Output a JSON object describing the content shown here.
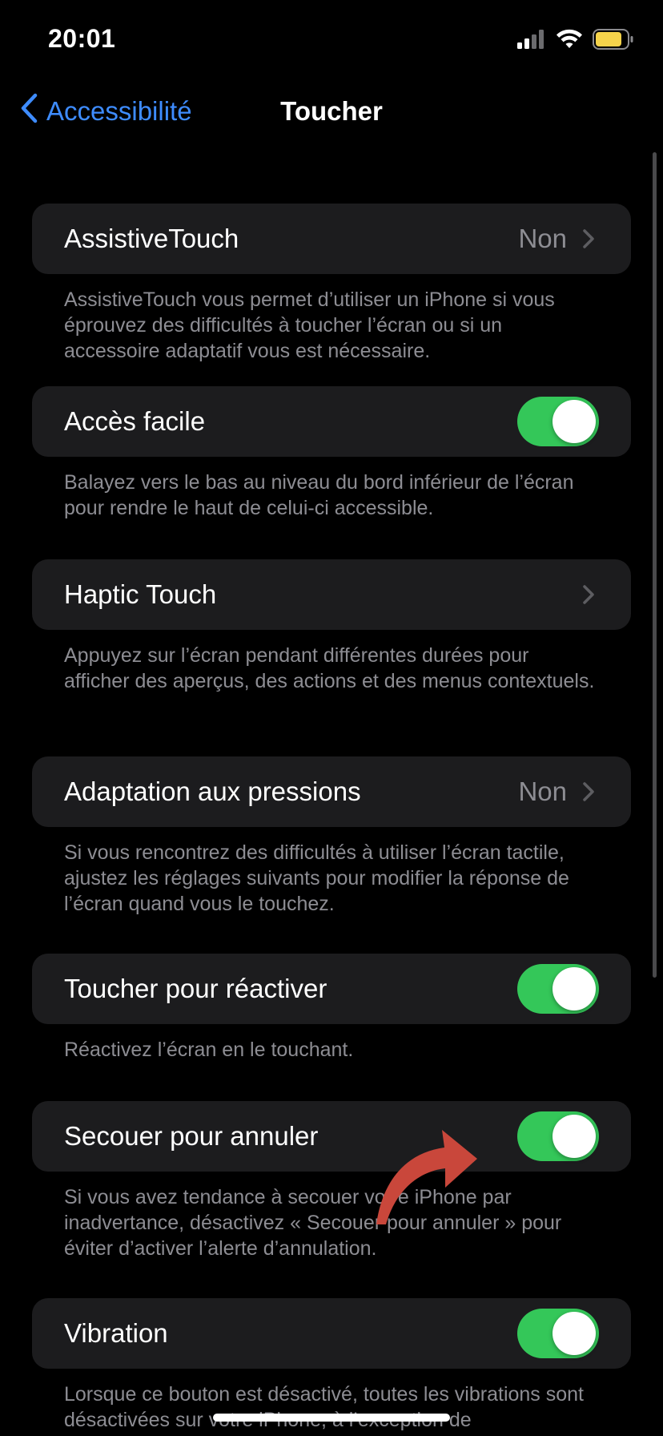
{
  "status_bar": {
    "time": "20:01",
    "battery_color": "#f5d34b",
    "icons": [
      "cellular-signal-icon",
      "wifi-icon",
      "battery-icon"
    ]
  },
  "nav": {
    "back_label": "Accessibilité",
    "title": "Toucher",
    "accent_color": "#3e8cff"
  },
  "sections": [
    {
      "label": "AssistiveTouch",
      "value": "Non",
      "control": "chevron",
      "footer": "AssistiveTouch vous permet d’utiliser un iPhone si vous éprouvez des difficultés à toucher l’écran ou si un accessoire adaptatif vous est nécessaire."
    },
    {
      "label": "Accès facile",
      "control": "toggle",
      "on": true,
      "footer": "Balayez vers le bas au niveau du bord inférieur de l’écran pour rendre le haut de celui-ci accessible."
    },
    {
      "label": "Haptic Touch",
      "control": "chevron",
      "footer": "Appuyez sur l’écran pendant différentes durées pour afficher des aperçus, des actions et des menus contextuels."
    },
    {
      "label": "Adaptation aux pressions",
      "value": "Non",
      "control": "chevron",
      "footer": "Si vous rencontrez des difficultés à utiliser l’écran tactile, ajustez les réglages suivants pour modifier la réponse de l’écran quand vous le touchez."
    },
    {
      "label": "Toucher pour réactiver",
      "control": "toggle",
      "on": true,
      "footer": "Réactivez l’écran en le touchant."
    },
    {
      "label": "Secouer pour annuler",
      "control": "toggle",
      "on": true,
      "footer": "Si vous avez tendance à secouer votre iPhone par inadvertance, désactivez « Secouer pour annuler » pour éviter d’activer l’alerte d’annulation."
    },
    {
      "label": "Vibration",
      "control": "toggle",
      "on": true,
      "footer": "Lorsque ce bouton est désactivé, toutes les vibrations sont désactivées sur votre iPhone, à l’exception de"
    }
  ],
  "colors": {
    "toggle_on": "#34c759",
    "cell_background": "#1c1c1e",
    "secondary_text": "#8d8d93",
    "annotation_arrow": "#c9473b"
  }
}
